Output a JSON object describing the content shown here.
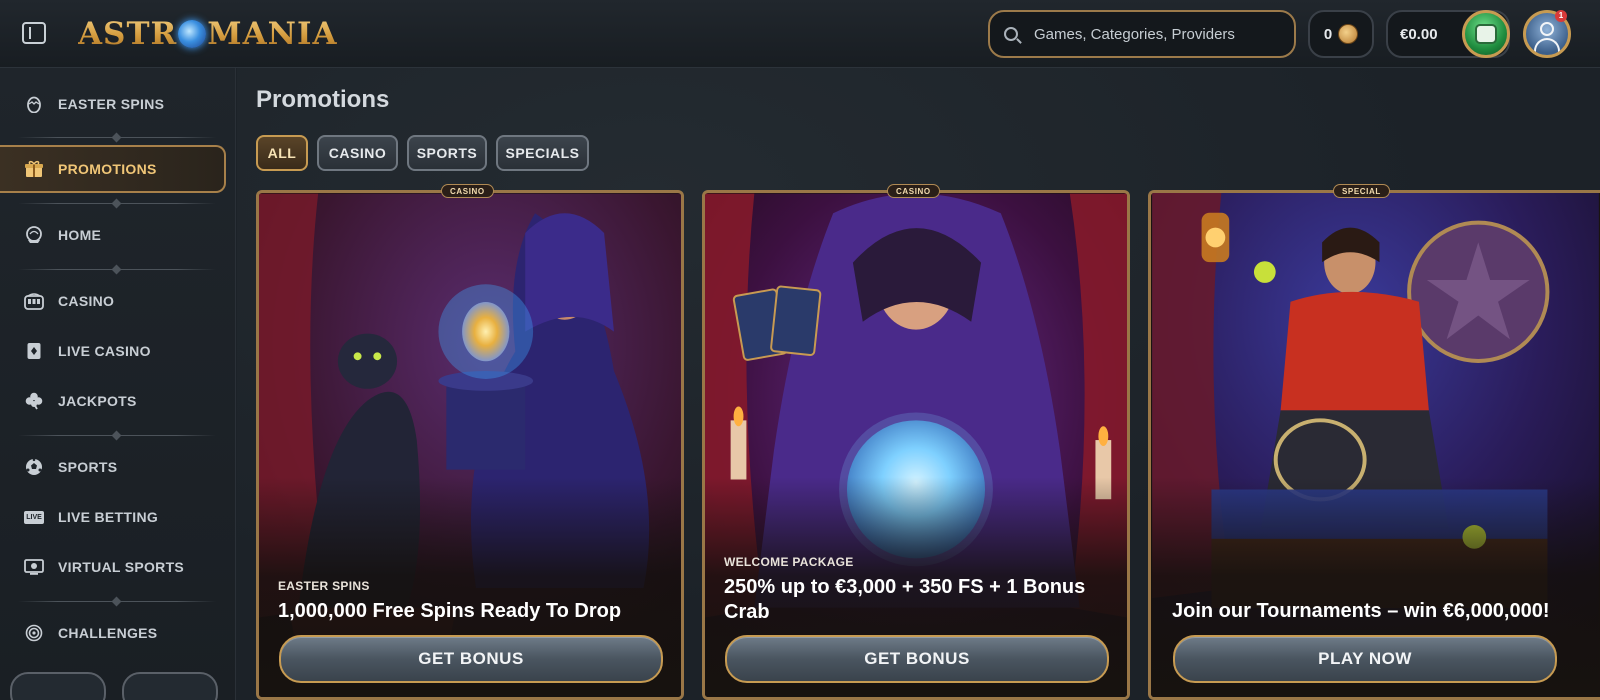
{
  "header": {
    "logo_text_left": "ASTR",
    "logo_text_right": "MANIA",
    "search_placeholder": "Games, Categories, Providers",
    "coins": "0",
    "balance": "€0.00",
    "notification_count": "1"
  },
  "sidebar": {
    "items": [
      {
        "label": "EASTER SPINS",
        "icon": "egg-icon"
      },
      {
        "label": "PROMOTIONS",
        "icon": "gift-icon",
        "active": true
      },
      {
        "label": "HOME",
        "icon": "home-icon"
      },
      {
        "label": "CASINO",
        "icon": "slot-machine-icon"
      },
      {
        "label": "LIVE CASINO",
        "icon": "playing-card-icon"
      },
      {
        "label": "JACKPOTS",
        "icon": "clover-icon"
      },
      {
        "label": "SPORTS",
        "icon": "soccer-ball-icon"
      },
      {
        "label": "LIVE BETTING",
        "icon": "live-icon"
      },
      {
        "label": "VIRTUAL SPORTS",
        "icon": "monitor-icon"
      },
      {
        "label": "CHALLENGES",
        "icon": "target-icon"
      }
    ],
    "live_badge": "LIVE"
  },
  "main": {
    "title": "Promotions",
    "filters": [
      {
        "label": "ALL",
        "active": true
      },
      {
        "label": "CASINO"
      },
      {
        "label": "SPORTS"
      },
      {
        "label": "SPECIALS"
      }
    ],
    "cards": [
      {
        "badge": "CASINO",
        "category": "EASTER SPINS",
        "title": "1,000,000 Free Spins Ready To Drop",
        "cta": "GET BONUS"
      },
      {
        "badge": "CASINO",
        "category": "WELCOME PACKAGE",
        "title": "250% up to €3,000 + 350 FS + 1 Bonus Crab",
        "cta": "GET BONUS"
      },
      {
        "badge": "SPECIAL",
        "category": "",
        "title": "Join our Tournaments – win €6,000,000!",
        "cta": "PLAY NOW"
      }
    ]
  },
  "colors": {
    "accent_gold": "#c79b52",
    "active_text": "#f0c677",
    "background": "#1c2228"
  }
}
